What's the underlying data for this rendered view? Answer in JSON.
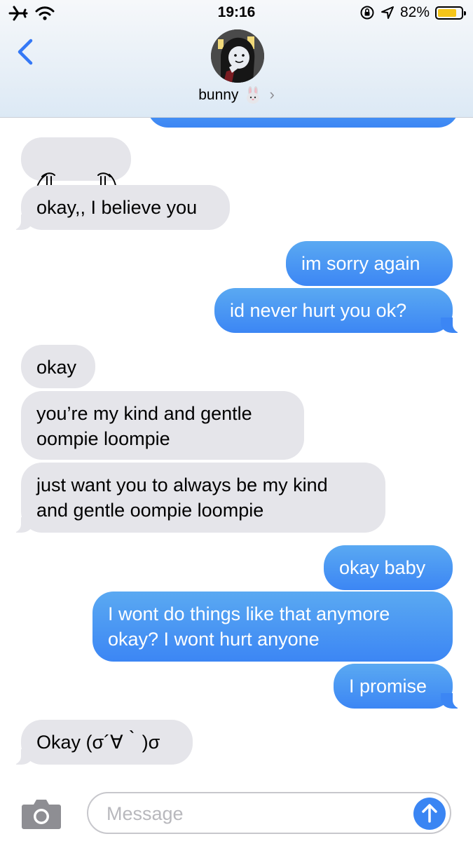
{
  "status_bar": {
    "time": "19:16",
    "battery_percent": "82%",
    "battery_level": 0.82,
    "icons": [
      "airplane-icon",
      "wifi-icon",
      "orientation-lock-icon",
      "location-icon",
      "battery-icon"
    ]
  },
  "header": {
    "contact_name": "bunny",
    "contact_emoji": "rabbit-emoji",
    "back_icon": "chevron-left-icon",
    "chevron": "›"
  },
  "messages": [
    {
      "side": "out",
      "text": ""
    },
    {
      "side": "in",
      "text": "/ᐢ|| ʷʷʷ ||ᐢ\\"
    },
    {
      "side": "in",
      "text": "okay,, I believe you"
    },
    {
      "side": "out",
      "text": "im sorry again"
    },
    {
      "side": "out",
      "text": "id never hurt you ok?"
    },
    {
      "side": "in",
      "text": "okay"
    },
    {
      "side": "in",
      "text": "you’re my kind and gentle\noompie loompie"
    },
    {
      "side": "in",
      "text": "just want you to always be my kind\nand gentle oompie loompie"
    },
    {
      "side": "out",
      "text": "okay baby"
    },
    {
      "side": "out",
      "text": "I wont do things like that anymore\nokay? I wont hurt anyone"
    },
    {
      "side": "out",
      "text": "I promise"
    },
    {
      "side": "in",
      "text": "Okay (σ´∀｀)σ"
    }
  ],
  "input": {
    "placeholder": "Message",
    "camera_icon": "camera-icon",
    "send_icon": "send-arrow-icon"
  },
  "colors": {
    "outgoing": "#3c86f4",
    "incoming": "#e5e5ea",
    "accent": "#3478f6"
  }
}
